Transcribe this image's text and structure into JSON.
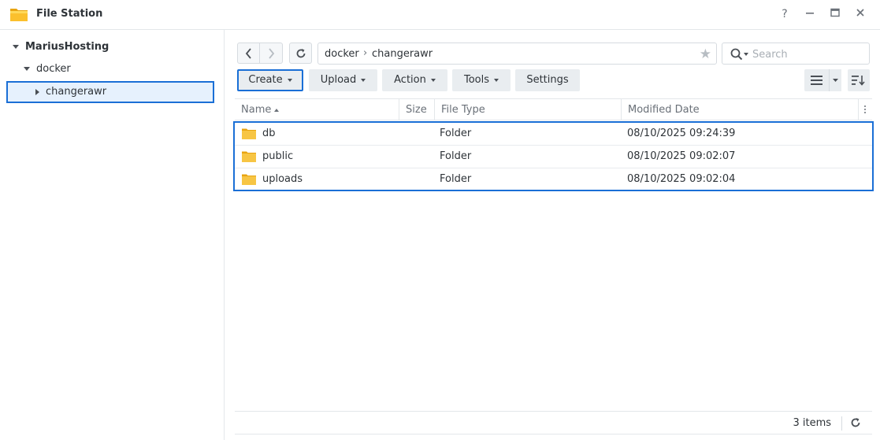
{
  "window": {
    "title": "File Station",
    "help_label": "?",
    "minimize_label": "—",
    "close_label": "✕"
  },
  "sidebar": {
    "root": "MariusHosting",
    "folder": "docker",
    "selected": "changerawr"
  },
  "breadcrumb": {
    "segments": [
      "docker",
      "changerawr"
    ],
    "separator": "›"
  },
  "search": {
    "placeholder": "Search"
  },
  "toolbar": {
    "create": "Create",
    "upload": "Upload",
    "action": "Action",
    "tools": "Tools",
    "settings": "Settings"
  },
  "table": {
    "columns": [
      "Name",
      "Size",
      "File Type",
      "Modified Date"
    ],
    "rows": [
      {
        "name": "db",
        "size": "",
        "type": "Folder",
        "modified": "08/10/2025 09:24:39"
      },
      {
        "name": "public",
        "size": "",
        "type": "Folder",
        "modified": "08/10/2025 09:02:07"
      },
      {
        "name": "uploads",
        "size": "",
        "type": "Folder",
        "modified": "08/10/2025 09:02:04"
      }
    ]
  },
  "footer": {
    "items_count": "3 items"
  },
  "colors": {
    "accent": "#1a6fd6",
    "folder": "#f7c544",
    "selection_bg": "#e6f1fd"
  }
}
